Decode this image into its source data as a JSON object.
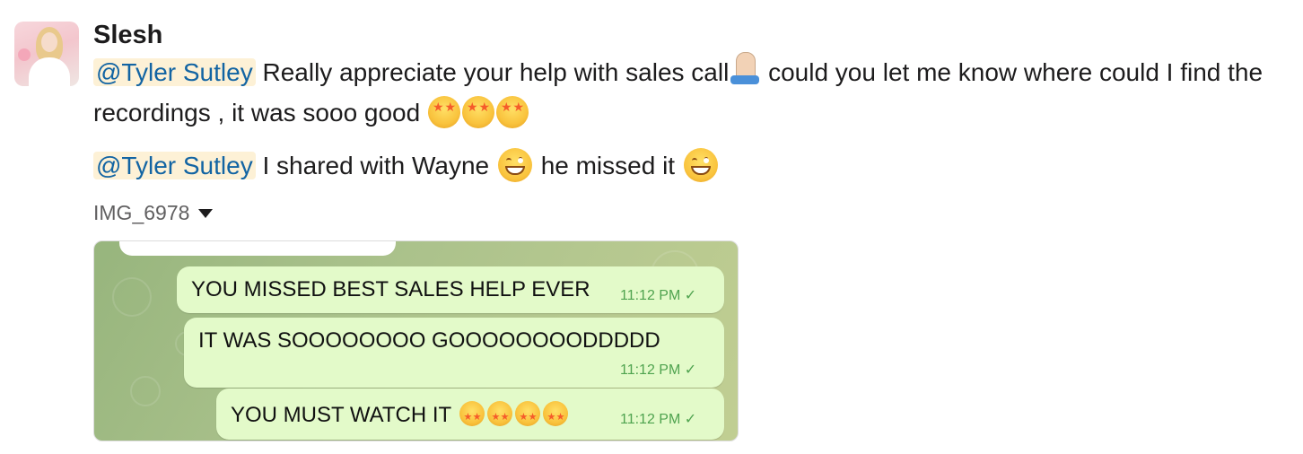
{
  "message": {
    "sender": "Slesh",
    "mention": "@Tyler Sutley",
    "line1_part1": "Really appreciate your help with sales call",
    "line1_part2": "could you let me know where could I find the recordings , it was sooo good",
    "mention2": "@Tyler Sutley",
    "line2_part1": "I shared with Wayne",
    "line2_part2": "he missed it",
    "emojis": {
      "pray": "pray-emoji",
      "star_struck": "star-struck-emoji",
      "grin": "grin-emoji"
    }
  },
  "attachment": {
    "name": "IMG_6978",
    "chat": {
      "messages": [
        {
          "text": "YOU MISSED BEST SALES HELP EVER",
          "time": "11:12 PM"
        },
        {
          "text": "IT WAS SOOOOOOOO GOOOOOOOODDDDD",
          "time": "11:12 PM"
        },
        {
          "text": "YOU MUST WATCH IT",
          "time": "11:12 PM"
        }
      ],
      "check": "✓"
    }
  },
  "colors": {
    "mention_text": "#1264a3",
    "mention_bg": "#fdf1d6",
    "bubble_bg": "#e3fac9",
    "time_green": "#4fa34f"
  }
}
